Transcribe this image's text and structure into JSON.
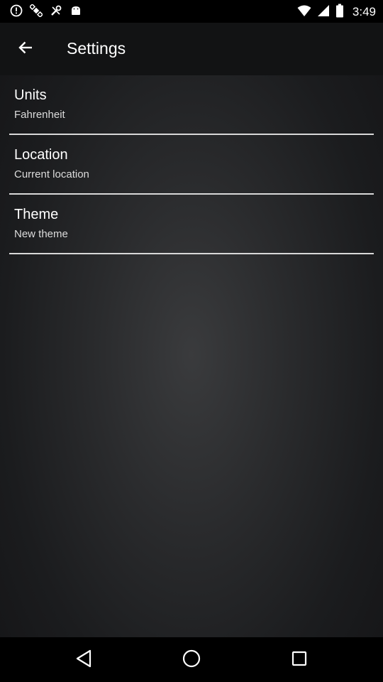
{
  "status_bar": {
    "time": "3:49",
    "left_icons": [
      "alert-circle-icon",
      "satellite-icon",
      "tools-icon",
      "android-icon"
    ],
    "right_icons": [
      "wifi-icon",
      "signal-icon",
      "battery-icon"
    ]
  },
  "app_bar": {
    "title": "Settings",
    "back_icon": "arrow-back-icon"
  },
  "settings": {
    "items": [
      {
        "title": "Units",
        "subtitle": "Fahrenheit"
      },
      {
        "title": "Location",
        "subtitle": "Current location"
      },
      {
        "title": "Theme",
        "subtitle": "New theme"
      }
    ]
  },
  "nav_bar": {
    "buttons": [
      "back-triangle-icon",
      "home-circle-icon",
      "recents-square-icon"
    ]
  },
  "colors": {
    "status_bar_bg": "#000000",
    "app_bar_bg": "#121314",
    "background_center": "#3a3b3d",
    "text_primary": "#ffffff",
    "text_secondary": "#dcdcdc",
    "divider": "#d8d8d8"
  }
}
